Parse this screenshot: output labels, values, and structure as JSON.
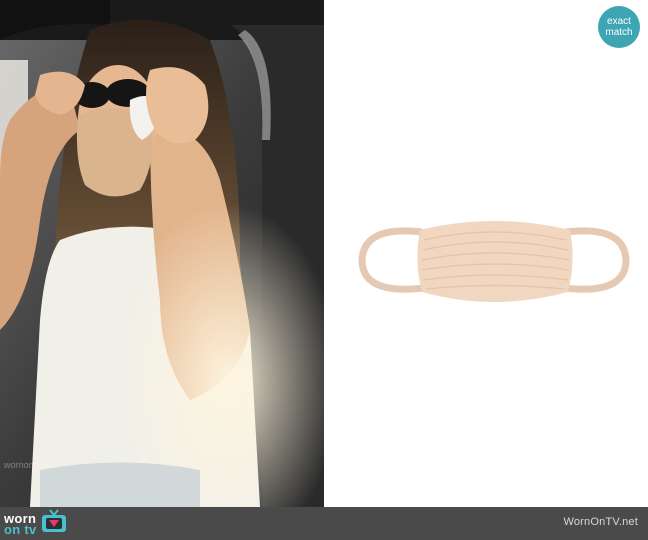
{
  "badge": {
    "line1": "exact",
    "line2": "match"
  },
  "footer": {
    "logo_line1": "worn",
    "logo_line2": "on tv",
    "site": "WornOnTV.net"
  },
  "photo": {
    "watermark": "wornontv.net"
  },
  "colors": {
    "accent": "#3ea6b3",
    "footer_bg": "#4a4a4a",
    "mask": "#e8c9ad"
  },
  "icons": [
    "tv-icon"
  ]
}
